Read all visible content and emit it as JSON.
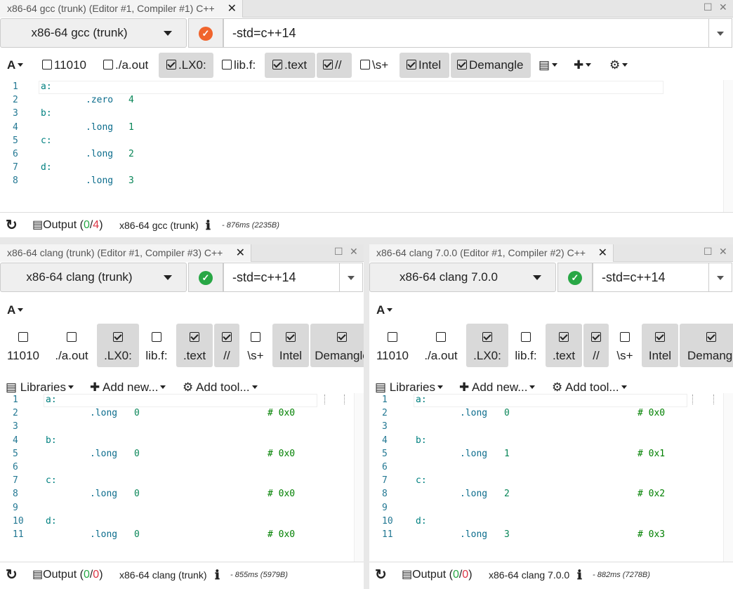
{
  "panes": {
    "gcc": {
      "tab_title": "x86-64 gcc (trunk) (Editor #1, Compiler #1) C++",
      "compiler": "x86-64 gcc (trunk)",
      "options": "-std=c++14",
      "status": "warning",
      "status_color": "#f0642c",
      "filters": {
        "bin": "11010",
        "aout": "./a.out",
        "lx0": ".LX0:",
        "libf": "lib.f:",
        "text": ".text",
        "comments": "//",
        "ws": "\\s+",
        "intel": "Intel",
        "demangle": "Demangle"
      },
      "code": [
        {
          "n": "1",
          "lbl": "a:"
        },
        {
          "n": "2",
          "dir": ".zero",
          "val": "4"
        },
        {
          "n": "3",
          "lbl": "b:"
        },
        {
          "n": "4",
          "dir": ".long",
          "val": "1"
        },
        {
          "n": "5",
          "lbl": "c:"
        },
        {
          "n": "6",
          "dir": ".long",
          "val": "2"
        },
        {
          "n": "7",
          "lbl": "d:"
        },
        {
          "n": "8",
          "dir": ".long",
          "val": "3"
        }
      ],
      "footer": {
        "output_label": "Output (",
        "ok_count": "0",
        "sep": "/",
        "err_count": "4",
        "close": ")",
        "compiler": "x86-64 gcc (trunk)",
        "timing": "- 876ms (2235B)"
      }
    },
    "clang_trunk": {
      "tab_title": "x86-64 clang (trunk) (Editor #1, Compiler #3) C++",
      "compiler": "x86-64 clang (trunk)",
      "options": "-std=c++14",
      "status": "ok",
      "status_color": "#28a745",
      "filters": {
        "bin": "11010",
        "aout": "./a.out",
        "lx0": ".LX0:",
        "libf": "lib.f:",
        "text": ".text",
        "comments": "//",
        "ws": "\\s+",
        "intel": "Intel",
        "demangle": "Demangle"
      },
      "libraries": "Libraries",
      "add_new": "Add new...",
      "add_tool": "Add tool...",
      "code": [
        {
          "n": "1",
          "lbl": "a:"
        },
        {
          "n": "2",
          "dir": ".long",
          "val": "0",
          "cmt": "# 0x0"
        },
        {
          "n": "3"
        },
        {
          "n": "4",
          "lbl": "b:"
        },
        {
          "n": "5",
          "dir": ".long",
          "val": "0",
          "cmt": "# 0x0"
        },
        {
          "n": "6"
        },
        {
          "n": "7",
          "lbl": "c:"
        },
        {
          "n": "8",
          "dir": ".long",
          "val": "0",
          "cmt": "# 0x0"
        },
        {
          "n": "9"
        },
        {
          "n": "10",
          "lbl": "d:"
        },
        {
          "n": "11",
          "dir": ".long",
          "val": "0",
          "cmt": "# 0x0"
        }
      ],
      "footer": {
        "output_label": "Output (",
        "ok_count": "0",
        "sep": "/",
        "err_count": "0",
        "close": ")",
        "compiler": "x86-64 clang (trunk)",
        "timing": "- 855ms (5979B)"
      }
    },
    "clang_7": {
      "tab_title": "x86-64 clang 7.0.0 (Editor #1, Compiler #2) C++",
      "compiler": "x86-64 clang 7.0.0",
      "options": "-std=c++14",
      "status": "ok",
      "status_color": "#28a745",
      "filters": {
        "bin": "11010",
        "aout": "./a.out",
        "lx0": ".LX0:",
        "libf": "lib.f:",
        "text": ".text",
        "comments": "//",
        "ws": "\\s+",
        "intel": "Intel",
        "demangle": "Demangl"
      },
      "libraries": "Libraries",
      "add_new": "Add new...",
      "add_tool": "Add tool...",
      "code": [
        {
          "n": "1",
          "lbl": "a:"
        },
        {
          "n": "2",
          "dir": ".long",
          "val": "0",
          "cmt": "# 0x0"
        },
        {
          "n": "3"
        },
        {
          "n": "4",
          "lbl": "b:"
        },
        {
          "n": "5",
          "dir": ".long",
          "val": "1",
          "cmt": "# 0x1"
        },
        {
          "n": "6"
        },
        {
          "n": "7",
          "lbl": "c:"
        },
        {
          "n": "8",
          "dir": ".long",
          "val": "2",
          "cmt": "# 0x2"
        },
        {
          "n": "9"
        },
        {
          "n": "10",
          "lbl": "d:"
        },
        {
          "n": "11",
          "dir": ".long",
          "val": "3",
          "cmt": "# 0x3"
        }
      ],
      "footer": {
        "output_label": "Output (",
        "ok_count": "0",
        "sep": "/",
        "err_count": "0",
        "close": ")",
        "compiler": "x86-64 clang 7.0.0",
        "timing": "- 882ms (7278B)"
      }
    }
  },
  "icons": {
    "font": "A",
    "close": "✕",
    "maximize": "☐",
    "info": "ℹ",
    "refresh": "↻",
    "book": "▤",
    "plus": "✚",
    "gears": "⚙"
  }
}
